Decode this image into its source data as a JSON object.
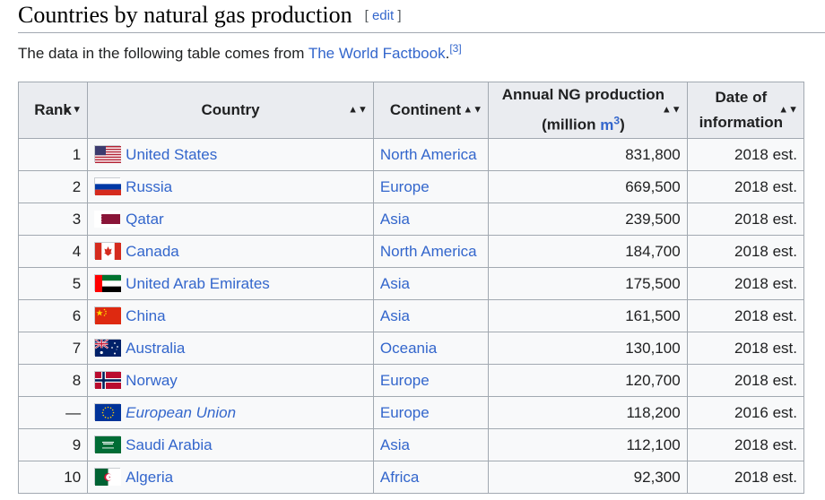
{
  "section": {
    "title": "Countries by natural gas production",
    "edit_open": "[",
    "edit_label": "edit",
    "edit_close": "]"
  },
  "intro": {
    "text": "The data in the following table comes from ",
    "link": "The World Factbook",
    "end": ".",
    "ref": "[3]"
  },
  "table": {
    "headers": {
      "rank": "Rank",
      "country": "Country",
      "continent": "Continent",
      "ngprod_line1": "Annual NG production",
      "ngprod_line2_pre": "(million ",
      "ngprod_unit": "m",
      "ngprod_unit_sup": "3",
      "ngprod_line2_post": ")",
      "date_line1": "Date of",
      "date_line2": "information"
    },
    "sort_icon": "sort-arrows",
    "rows": [
      {
        "rank": "1",
        "flag": "flag-united-states",
        "country": "United States",
        "continent": "North America",
        "production": "831,800",
        "date": "2018 est."
      },
      {
        "rank": "2",
        "flag": "flag-russia",
        "country": "Russia",
        "continent": "Europe",
        "production": "669,500",
        "date": "2018 est."
      },
      {
        "rank": "3",
        "flag": "flag-qatar",
        "country": "Qatar",
        "continent": "Asia",
        "production": "239,500",
        "date": "2018 est."
      },
      {
        "rank": "4",
        "flag": "flag-canada",
        "country": "Canada",
        "continent": "North America",
        "production": "184,700",
        "date": "2018 est."
      },
      {
        "rank": "5",
        "flag": "flag-uae",
        "country": "United Arab Emirates",
        "continent": "Asia",
        "production": "175,500",
        "date": "2018 est."
      },
      {
        "rank": "6",
        "flag": "flag-china",
        "country": "China",
        "continent": "Asia",
        "production": "161,500",
        "date": "2018 est."
      },
      {
        "rank": "7",
        "flag": "flag-australia",
        "country": "Australia",
        "continent": "Oceania",
        "production": "130,100",
        "date": "2018 est."
      },
      {
        "rank": "8",
        "flag": "flag-norway",
        "country": "Norway",
        "continent": "Europe",
        "production": "120,700",
        "date": "2018 est."
      },
      {
        "rank": "—",
        "flag": "flag-european-union",
        "country": "European Union",
        "continent": "Europe",
        "production": "118,200",
        "date": "2016 est."
      },
      {
        "rank": "9",
        "flag": "flag-saudi-arabia",
        "country": "Saudi Arabia",
        "continent": "Asia",
        "production": "112,100",
        "date": "2018 est."
      },
      {
        "rank": "10",
        "flag": "flag-algeria",
        "country": "Algeria",
        "continent": "Africa",
        "production": "92,300",
        "date": "2018 est."
      }
    ]
  },
  "colors": {
    "link": "#3366cc",
    "header_bg": "#eaecf0",
    "cell_bg": "#f8f9fa",
    "border": "#a2a9b1"
  }
}
